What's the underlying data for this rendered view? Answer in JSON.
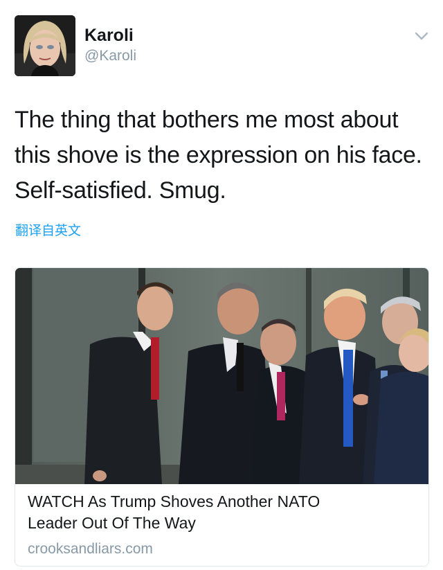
{
  "user": {
    "display_name": "Karoli",
    "handle": "@Karoli"
  },
  "tweet": {
    "text_lines": [
      "The thing that bothers me most about",
      "this shove is the expression on his face.",
      "Self-satisfied. Smug."
    ],
    "translate_label": "翻译自英文"
  },
  "card": {
    "title_lines": [
      "WATCH As Trump Shoves Another NATO",
      "Leader Out Of The Way"
    ],
    "domain": "crooksandliars.com"
  },
  "icons": {
    "menu": "chevron-down-icon"
  },
  "colors": {
    "link": "#1da1f2",
    "secondary_text": "#8899a6",
    "primary_text": "#14171a",
    "border": "#e1e8ed"
  }
}
